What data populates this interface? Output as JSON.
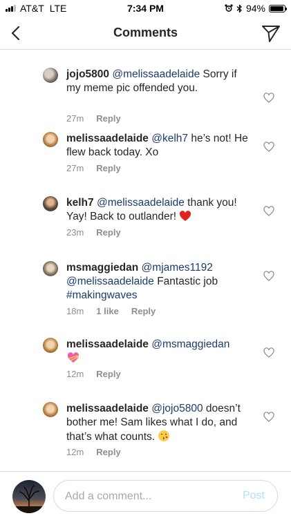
{
  "status_bar": {
    "carrier": "AT&T",
    "network": "LTE",
    "time": "7:34 PM",
    "battery": "94%",
    "battery_level": 0.94
  },
  "nav": {
    "title": "Comments",
    "back_icon": "chevron-left-icon",
    "send_icon": "paper-plane-icon"
  },
  "comments": [
    {
      "user": "jojo5800",
      "mention": "@melissaadelaide",
      "text": " Sorry if my meme pic offended you.",
      "time": "27m",
      "reply": "Reply"
    },
    {
      "user": "melissaadelaide",
      "mention": "@kelh7",
      "text": " he’s not! He flew back today. Xo",
      "time": "27m",
      "reply": "Reply"
    },
    {
      "user": "kelh7",
      "mention": "@melissaadelaide",
      "text": " thank you! Yay! Back to outlander! ",
      "emoji": "red-heart-icon",
      "time": "23m",
      "reply": "Reply"
    },
    {
      "user": "msmaggiedan",
      "mention": "@mjames1192",
      "mention2": "@melissaadelaide",
      "text": " Fantastic job ",
      "hashtag": "#makingwaves",
      "time": "18m",
      "likes": "1 like",
      "reply": "Reply"
    },
    {
      "user": "melissaadelaide",
      "mention": "@msmaggiedan",
      "emoji": "heart-with-ribbon-icon",
      "time": "12m",
      "reply": "Reply"
    },
    {
      "user": "melissaadelaide",
      "mention": "@jojo5800",
      "text": " doesn’t bother me! Sam likes what I do, and that’s what counts. ",
      "emoji": "face-blowing-kiss-icon",
      "time": "12m",
      "reply": "Reply"
    }
  ],
  "composer": {
    "placeholder": "Add a comment...",
    "post_label": "Post"
  },
  "colors": {
    "mention": "#1c3b6e",
    "meta": "#8e8e8e",
    "post_disabled": "#b2dffc",
    "divider": "#dbdbdb"
  }
}
